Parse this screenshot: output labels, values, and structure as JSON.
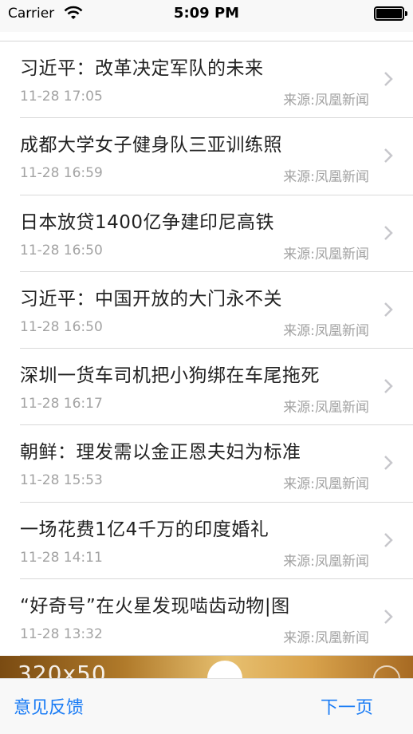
{
  "status_bar": {
    "carrier": "Carrier",
    "time": "5:09 PM",
    "wifi_icon": "wifi-icon",
    "battery_icon": "battery-icon"
  },
  "news": [
    {
      "title": "习近平：改革决定军队的未来",
      "time": "11-28 17:05",
      "source": "来源:凤凰新闻"
    },
    {
      "title": "成都大学女子健身队三亚训练照",
      "time": "11-28 16:59",
      "source": "来源:凤凰新闻"
    },
    {
      "title": "日本放贷1400亿争建印尼高铁",
      "time": "11-28 16:50",
      "source": "来源:凤凰新闻"
    },
    {
      "title": "习近平：中国开放的大门永不关",
      "time": "11-28 16:50",
      "source": "来源:凤凰新闻"
    },
    {
      "title": "深圳一货车司机把小狗绑在车尾拖死",
      "time": "11-28 16:17",
      "source": "来源:凤凰新闻"
    },
    {
      "title": "朝鲜：理发需以金正恩夫妇为标准",
      "time": "11-28 15:53",
      "source": "来源:凤凰新闻"
    },
    {
      "title": "一场花费1亿4千万的印度婚礼",
      "time": "11-28 14:11",
      "source": "来源:凤凰新闻"
    },
    {
      "title": "“好奇号”在火星发现啮齿动物|图",
      "time": "11-28 13:32",
      "source": "来源:凤凰新闻"
    }
  ],
  "ad_banner": {
    "text": "320x50"
  },
  "toolbar": {
    "feedback_label": "意见反馈",
    "next_page_label": "下一页"
  },
  "colors": {
    "accent": "#1a7cf5",
    "meta_text": "#a3a3a3",
    "title_text": "#222222"
  }
}
